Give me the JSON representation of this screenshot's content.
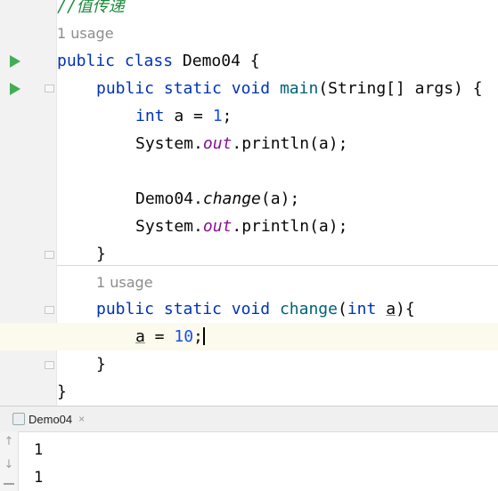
{
  "editor": {
    "comment_line": "//值传递",
    "usage_1": "1 usage",
    "usage_2": "1 usage",
    "line_class": {
      "kw1": "public",
      "kw2": "class",
      "name": "Demo04",
      "brace": " {"
    },
    "line_main": {
      "kw1": "public",
      "kw2": "static",
      "kw3": "void",
      "fn": "main",
      "rest": "(String[] args) {"
    },
    "line_int": {
      "kw": "int",
      "mid": " a = ",
      "num": "1",
      "end": ";"
    },
    "line_print1": {
      "pre": "System.",
      "field": "out",
      "post": ".println(a);"
    },
    "line_change_call": {
      "cls": "Demo04.",
      "method": "change",
      "args": "(a);"
    },
    "line_print2": {
      "pre": "System.",
      "field": "out",
      "post": ".println(a);"
    },
    "close_method": "}",
    "line_change_decl": {
      "kw1": "public",
      "kw2": "static",
      "kw3": "void",
      "fn": "change",
      "open": "(",
      "kw4": "int",
      "param": "a",
      "close": "){"
    },
    "line_assign": {
      "param": "a",
      "mid": " = ",
      "num": "10",
      "end": ";"
    },
    "close_change": "}",
    "close_class": "}"
  },
  "run_panel": {
    "tab_label": "Demo04",
    "tab_close": "×",
    "output": [
      "1",
      "1"
    ],
    "scroll_up": "↑",
    "scroll_down": "↓"
  }
}
